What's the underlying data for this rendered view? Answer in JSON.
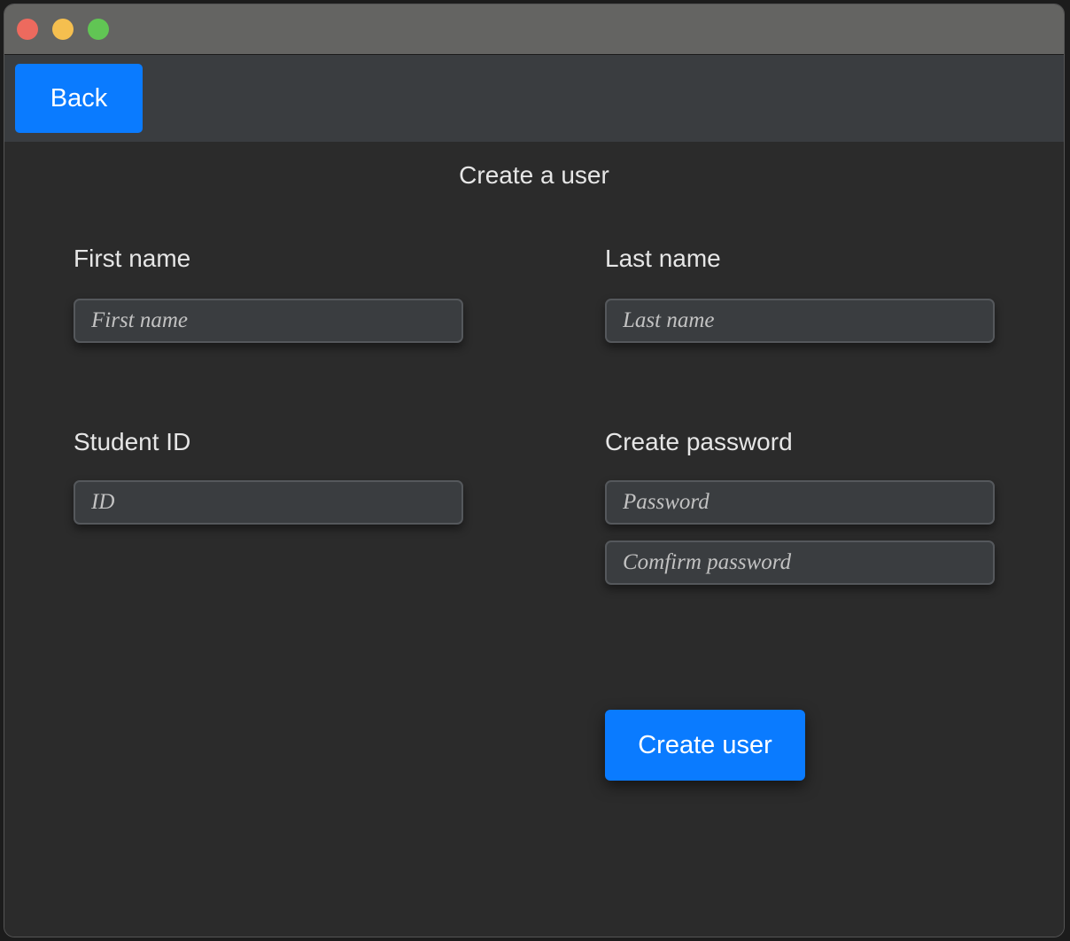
{
  "window": {
    "controls": [
      "close",
      "minimize",
      "maximize"
    ]
  },
  "toolbar": {
    "back_label": "Back"
  },
  "form": {
    "title": "Create a user",
    "first_name": {
      "label": "First name",
      "placeholder": "First name",
      "value": ""
    },
    "last_name": {
      "label": "Last name",
      "placeholder": "Last name",
      "value": ""
    },
    "student_id": {
      "label": "Student ID",
      "placeholder": "ID",
      "value": ""
    },
    "password": {
      "label": "Create password",
      "placeholder": "Password",
      "confirm_placeholder": "Comfirm password",
      "value": ""
    },
    "submit_label": "Create user"
  },
  "colors": {
    "accent": "#0a7bff",
    "background": "#2b2b2b",
    "toolbar": "#3a3d40",
    "titlebar": "#646462"
  }
}
